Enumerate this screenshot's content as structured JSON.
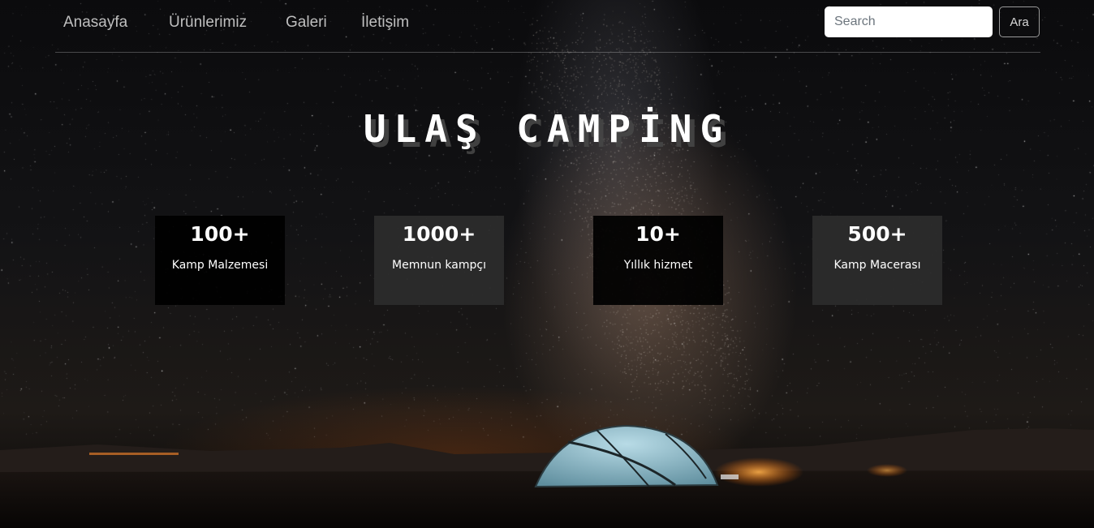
{
  "nav": {
    "links": [
      {
        "label": "Anasayfa"
      },
      {
        "label": "Ürünlerimiz"
      },
      {
        "label": "Galeri"
      },
      {
        "label": "İletişim"
      }
    ],
    "search_placeholder": "Search",
    "search_button": "Ara"
  },
  "hero": {
    "title": "ULAŞ CAMPİNG"
  },
  "stats": [
    {
      "value": "100+",
      "label": "Kamp Malzemesi"
    },
    {
      "value": "1000+",
      "label": "Memnun kampçı"
    },
    {
      "value": "10+",
      "label": "Yıllık hizmet"
    },
    {
      "value": "500+",
      "label": "Kamp Macerası"
    }
  ],
  "colors": {
    "card_dark": "#000000",
    "card_grey": "#2d2d2d",
    "nav_text": "#bfbfbf",
    "tent": "#8fb6c4"
  },
  "background": {
    "icon": "night-sky-tent-photo"
  }
}
